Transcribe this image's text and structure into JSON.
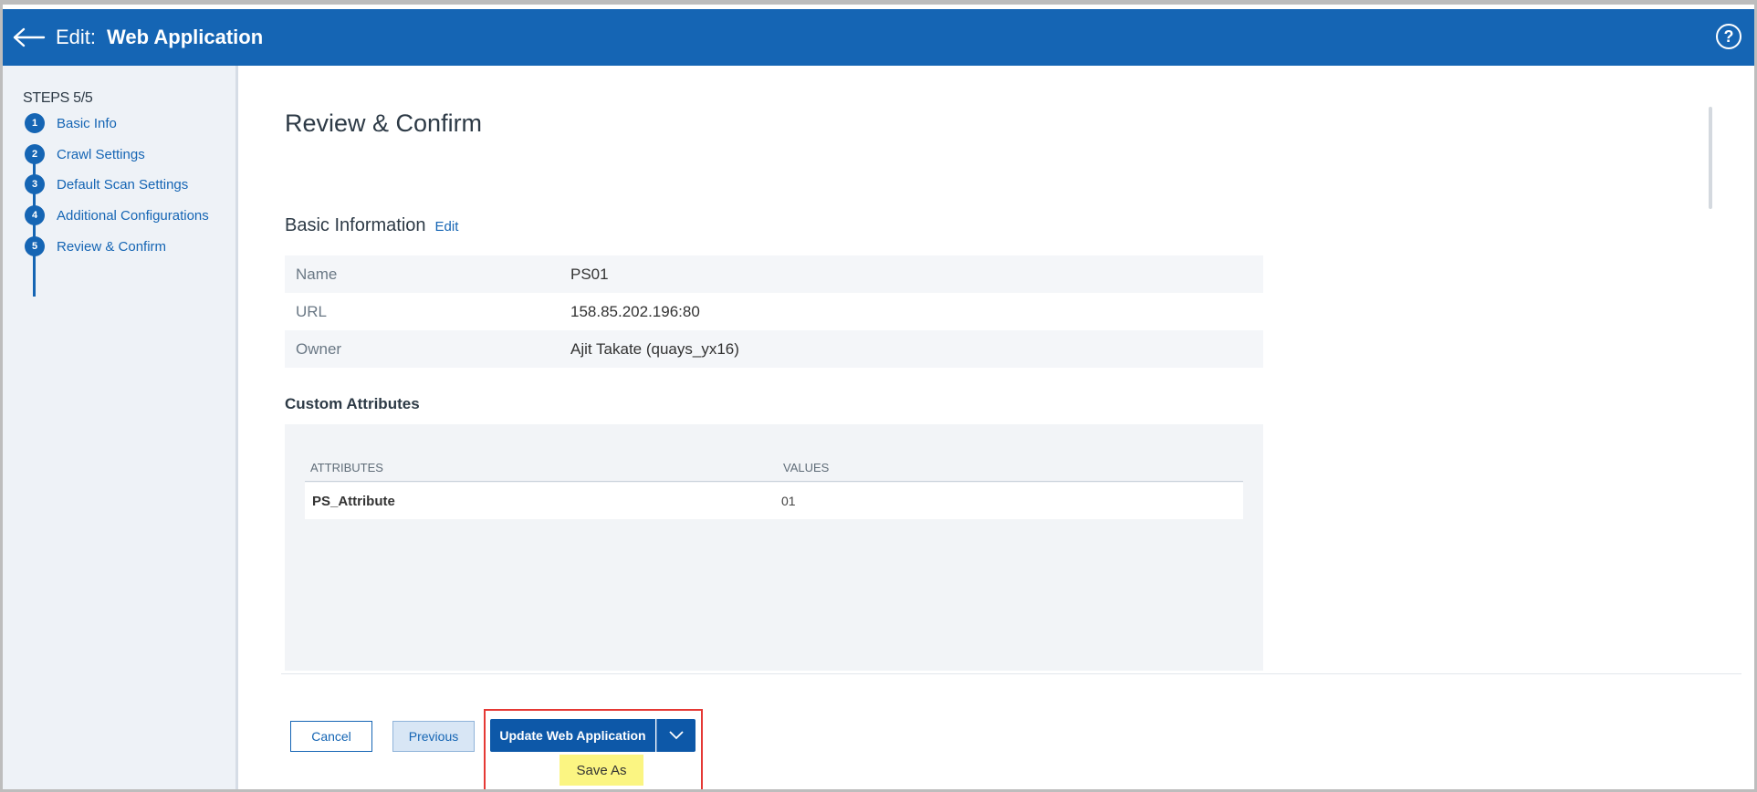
{
  "header": {
    "title_prefix": "Edit:",
    "title_name": "Web Application",
    "help_glyph": "?"
  },
  "sidebar": {
    "steps_label": "STEPS 5/5",
    "steps": [
      {
        "num": "1",
        "label": "Basic Info"
      },
      {
        "num": "2",
        "label": "Crawl Settings"
      },
      {
        "num": "3",
        "label": "Default Scan Settings"
      },
      {
        "num": "4",
        "label": "Additional Configurations"
      },
      {
        "num": "5",
        "label": "Review & Confirm"
      }
    ]
  },
  "main": {
    "title": "Review & Confirm",
    "basic_info": {
      "title": "Basic Information",
      "edit_label": "Edit",
      "rows": [
        {
          "key": "Name",
          "value": "PS01"
        },
        {
          "key": "URL",
          "value": "158.85.202.196:80"
        },
        {
          "key": "Owner",
          "value": "Ajit Takate (quays_yx16)"
        }
      ]
    },
    "custom_attributes": {
      "title": "Custom Attributes",
      "col_attributes": "ATTRIBUTES",
      "col_values": "VALUES",
      "rows": [
        {
          "attribute": "PS_Attribute",
          "value": "01"
        }
      ]
    }
  },
  "footer": {
    "cancel_label": "Cancel",
    "previous_label": "Previous",
    "update_label": "Update Web Application",
    "save_as_label": "Save As"
  },
  "colors": {
    "primary": "#1565b4",
    "highlight_border": "#e53935",
    "save_as_bg": "#fbf582"
  }
}
